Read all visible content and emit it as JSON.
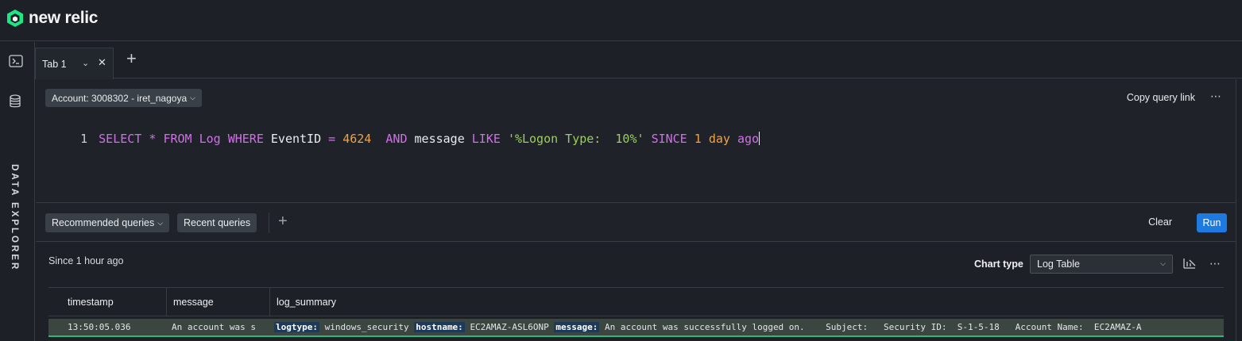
{
  "brand": {
    "name": "new relic",
    "accent": "#1ce783"
  },
  "rail": {
    "label": "DATA EXPLORER",
    "icons": [
      "terminal-icon",
      "database-icon"
    ]
  },
  "tabs": [
    {
      "label": "Tab 1"
    }
  ],
  "editor": {
    "account": "Account: 3008302 - iret_nagoya",
    "copy_link": "Copy query link",
    "line_number": "1",
    "query_tokens": [
      {
        "t": "SELECT",
        "c": "kw"
      },
      {
        "t": " ",
        "c": "ident"
      },
      {
        "t": "*",
        "c": "kw"
      },
      {
        "t": " ",
        "c": "ident"
      },
      {
        "t": "FROM",
        "c": "kw"
      },
      {
        "t": " ",
        "c": "ident"
      },
      {
        "t": "Log",
        "c": "kw"
      },
      {
        "t": " ",
        "c": "ident"
      },
      {
        "t": "WHERE",
        "c": "kw"
      },
      {
        "t": " EventID ",
        "c": "ident"
      },
      {
        "t": "=",
        "c": "kw"
      },
      {
        "t": " ",
        "c": "ident"
      },
      {
        "t": "4624",
        "c": "num"
      },
      {
        "t": "  ",
        "c": "ident"
      },
      {
        "t": "AND",
        "c": "kw"
      },
      {
        "t": " message ",
        "c": "ident"
      },
      {
        "t": "LIKE",
        "c": "kw"
      },
      {
        "t": " ",
        "c": "ident"
      },
      {
        "t": "'%Logon Type:  10%'",
        "c": "str"
      },
      {
        "t": " ",
        "c": "ident"
      },
      {
        "t": "SINCE",
        "c": "kw"
      },
      {
        "t": " ",
        "c": "ident"
      },
      {
        "t": "1",
        "c": "num"
      },
      {
        "t": " ",
        "c": "ident"
      },
      {
        "t": "day",
        "c": "num"
      },
      {
        "t": " ",
        "c": "ident"
      },
      {
        "t": "ago",
        "c": "kw"
      }
    ]
  },
  "query_bar": {
    "recommended": "Recommended queries",
    "recent": "Recent queries",
    "clear": "Clear",
    "run": "Run"
  },
  "results": {
    "since": "Since 1 hour ago",
    "chart_type_label": "Chart type",
    "chart_type_value": "Log Table",
    "columns": [
      "timestamp",
      "message",
      "log_summary"
    ],
    "rows": [
      {
        "timestamp": "13:50:05.036",
        "message": "An account was s",
        "summary": [
          {
            "tag": "logtype:",
            "value": "windows_security"
          },
          {
            "tag": "hostname:",
            "value": "EC2AMAZ-ASL6ONP"
          },
          {
            "tag": "message:",
            "value": "An account was successfully logged on.    Subject:   Security ID:  S-1-5-18   Account Name:  EC2AMAZ-A"
          }
        ]
      }
    ]
  }
}
